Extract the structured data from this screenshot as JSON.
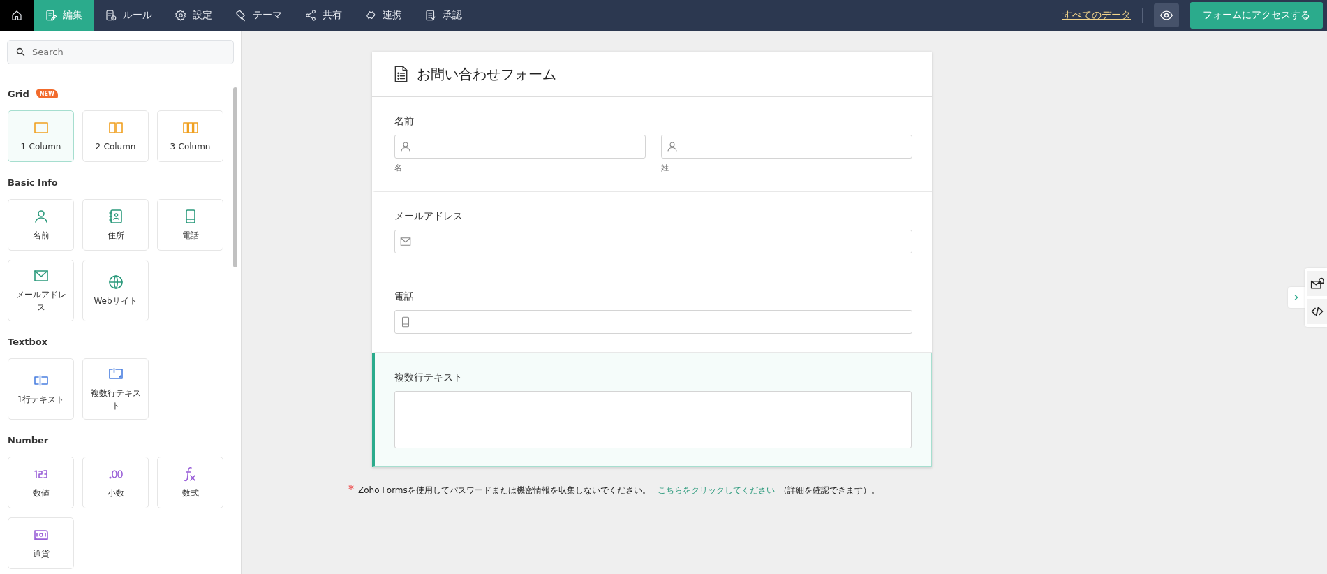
{
  "nav": {
    "tabs": [
      {
        "kind": "home",
        "selected": false
      },
      {
        "kind": "edit",
        "label": "編集",
        "selected": true
      },
      {
        "kind": "rules",
        "label": "ルール",
        "selected": false
      },
      {
        "kind": "settings",
        "label": "設定",
        "selected": false
      },
      {
        "kind": "theme",
        "label": "テーマ",
        "selected": false
      },
      {
        "kind": "share",
        "label": "共有",
        "selected": false
      },
      {
        "kind": "integrate",
        "label": "連携",
        "selected": false
      },
      {
        "kind": "approve",
        "label": "承認",
        "selected": false
      }
    ],
    "all_data_link": "すべてのデータ",
    "access_button": "フォームにアクセスする"
  },
  "sidebar": {
    "search": {
      "placeholder": "Search"
    },
    "sections": [
      {
        "title": "Grid",
        "badge": "NEW",
        "items": [
          {
            "kind": "col1",
            "label": "1-Column",
            "selected": true
          },
          {
            "kind": "col2",
            "label": "2-Column",
            "selected": false
          },
          {
            "kind": "col3",
            "label": "3-Column",
            "selected": false
          }
        ]
      },
      {
        "title": "Basic Info",
        "items": [
          {
            "kind": "person",
            "label": "名前",
            "selected": false
          },
          {
            "kind": "address",
            "label": "住所",
            "selected": false
          },
          {
            "kind": "phone",
            "label": "電話",
            "selected": false
          },
          {
            "kind": "mail",
            "label": "メールアドレス",
            "selected": false
          },
          {
            "kind": "globe",
            "label": "Webサイト",
            "selected": false
          }
        ]
      },
      {
        "title": "Textbox",
        "items": [
          {
            "kind": "singleline",
            "label": "1行テキスト",
            "selected": false
          },
          {
            "kind": "multiline",
            "label": "複数行テキスト",
            "selected": false
          }
        ]
      },
      {
        "title": "Number",
        "items": [
          {
            "kind": "number",
            "label": "数値",
            "selected": false
          },
          {
            "kind": "decimal",
            "label": "小数",
            "selected": false
          },
          {
            "kind": "formula",
            "label": "数式",
            "selected": false
          },
          {
            "kind": "currency",
            "label": "通貨",
            "selected": false
          }
        ]
      }
    ]
  },
  "form": {
    "title": "お問い合わせフォーム",
    "fields": [
      {
        "kind": "name",
        "label": "名前",
        "selected": false,
        "subfields": [
          {
            "caption": "名"
          },
          {
            "caption": "姓"
          }
        ]
      },
      {
        "kind": "email",
        "label": "メールアドレス",
        "selected": false
      },
      {
        "kind": "phone",
        "label": "電話",
        "selected": false
      },
      {
        "kind": "multiline",
        "label": "複数行テキスト",
        "selected": true
      }
    ]
  },
  "notice": {
    "mark": "*",
    "text": "Zoho Formsを使用してパスワードまたは機密情報を収集しないでください。",
    "link": "こちらをクリックしてください",
    "suffix": "（詳細を確認できます）。"
  }
}
